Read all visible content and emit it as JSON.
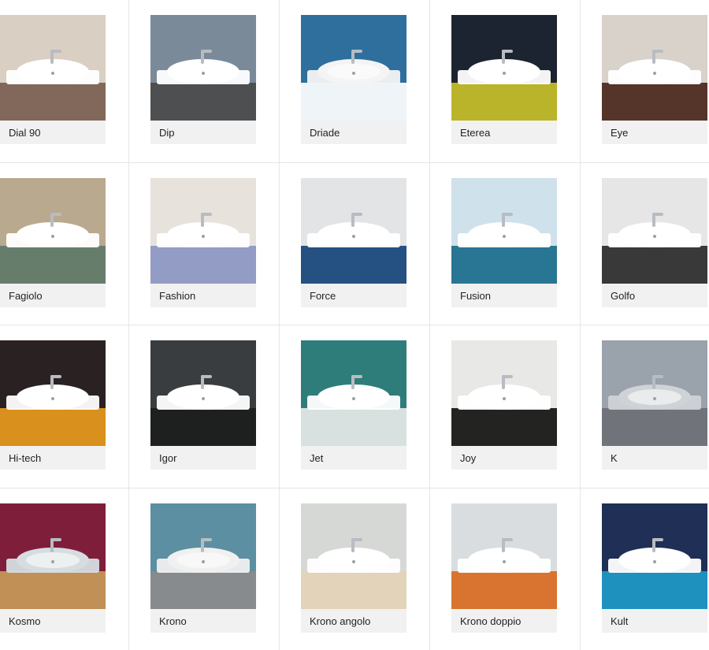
{
  "products": [
    {
      "name": "Dial 90",
      "thumb": {
        "bg": "#d9cfc2",
        "accent": "#7a5f52",
        "basin": "#ffffff"
      }
    },
    {
      "name": "Dip",
      "thumb": {
        "bg": "#7a8a99",
        "accent": "#4a4a4a",
        "basin": "#ffffff"
      }
    },
    {
      "name": "Driade",
      "thumb": {
        "bg": "#2e6f9e",
        "accent": "#ffffff",
        "basin": "#f4f4f4"
      }
    },
    {
      "name": "Eterea",
      "thumb": {
        "bg": "#1b2430",
        "accent": "#c8c12a",
        "basin": "#ffffff"
      }
    },
    {
      "name": "Eye",
      "thumb": {
        "bg": "#d8d2cb",
        "accent": "#4a261c",
        "basin": "#ffffff"
      }
    },
    {
      "name": "Fagiolo",
      "thumb": {
        "bg": "#b9a98f",
        "accent": "#5f7a69",
        "basin": "#ffffff"
      }
    },
    {
      "name": "Fashion",
      "thumb": {
        "bg": "#e7e2dc",
        "accent": "#8c96c2",
        "basin": "#ffffff"
      }
    },
    {
      "name": "Force",
      "thumb": {
        "bg": "#e2e4e6",
        "accent": "#15447a",
        "basin": "#ffffff"
      }
    },
    {
      "name": "Fusion",
      "thumb": {
        "bg": "#cfe1ea",
        "accent": "#1b6b8c",
        "basin": "#ffffff"
      }
    },
    {
      "name": "Golfo",
      "thumb": {
        "bg": "#e6e6e6",
        "accent": "#2a2a2a",
        "basin": "#ffffff"
      }
    },
    {
      "name": "Hi-tech",
      "thumb": {
        "bg": "#2a2222",
        "accent": "#e89a1c",
        "basin": "#ffffff"
      }
    },
    {
      "name": "Igor",
      "thumb": {
        "bg": "#3a3d3f",
        "accent": "#1c1c1c",
        "basin": "#ffffff"
      }
    },
    {
      "name": "Jet",
      "thumb": {
        "bg": "#2f7d7a",
        "accent": "#e8e8e8",
        "basin": "#ffffff"
      }
    },
    {
      "name": "Joy",
      "thumb": {
        "bg": "#e8e8e6",
        "accent": "#111111",
        "basin": "#ffffff"
      }
    },
    {
      "name": "K",
      "thumb": {
        "bg": "#9aa2ab",
        "accent": "#6d6f74",
        "basin": "#cfd2d6"
      }
    },
    {
      "name": "Kosmo",
      "thumb": {
        "bg": "#7e1e3a",
        "accent": "#c79a5a",
        "basin": "#d6dde0"
      }
    },
    {
      "name": "Krono",
      "thumb": {
        "bg": "#5b8fa1",
        "accent": "#8b8b8b",
        "basin": "#f0f0f0"
      }
    },
    {
      "name": "Krono angolo",
      "thumb": {
        "bg": "#d6d8d6",
        "accent": "#e4d3b7",
        "basin": "#ffffff"
      }
    },
    {
      "name": "Krono doppio",
      "thumb": {
        "bg": "#d9dde0",
        "accent": "#d86a1f",
        "basin": "#ffffff"
      }
    },
    {
      "name": "Kult",
      "thumb": {
        "bg": "#1f2f55",
        "accent": "#1f9ac9",
        "basin": "#ffffff"
      }
    }
  ]
}
